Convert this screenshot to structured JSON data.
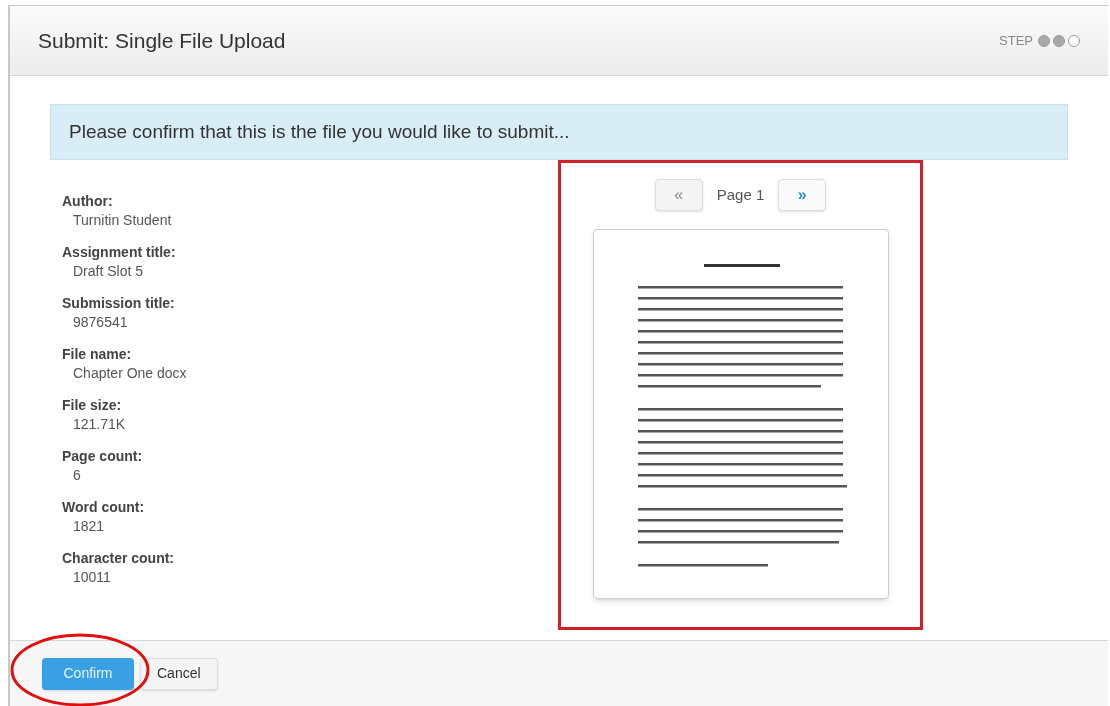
{
  "window": {
    "title": "Submit: Single File Upload"
  },
  "step": {
    "label": "STEP",
    "dots": [
      {
        "filled": true
      },
      {
        "filled": true
      },
      {
        "filled": false
      }
    ]
  },
  "notice": "Please confirm that this is the file you would like to submit...",
  "details": [
    {
      "label": "Author:",
      "value": "Turnitin Student"
    },
    {
      "label": "Assignment title:",
      "value": "Draft Slot 5"
    },
    {
      "label": "Submission title:",
      "value": "9876541"
    },
    {
      "label": "File name:",
      "value": "Chapter One docx"
    },
    {
      "label": "File size:",
      "value": "121.71K"
    },
    {
      "label": "Page count:",
      "value": "6"
    },
    {
      "label": "Word count:",
      "value": "1821"
    },
    {
      "label": "Character count:",
      "value": "10011"
    }
  ],
  "pager": {
    "prev": {
      "label": "«",
      "disabled": true
    },
    "page": "Page 1",
    "next": {
      "label": "»",
      "disabled": false
    }
  },
  "buttons": [
    {
      "label": "Confirm",
      "kind": "primary"
    },
    {
      "label": "Cancel",
      "kind": "secondary"
    }
  ],
  "annotations": [
    {
      "kind": "frame",
      "color": "#d0202a"
    },
    {
      "kind": "ellipse",
      "color": "#e01010"
    }
  ]
}
